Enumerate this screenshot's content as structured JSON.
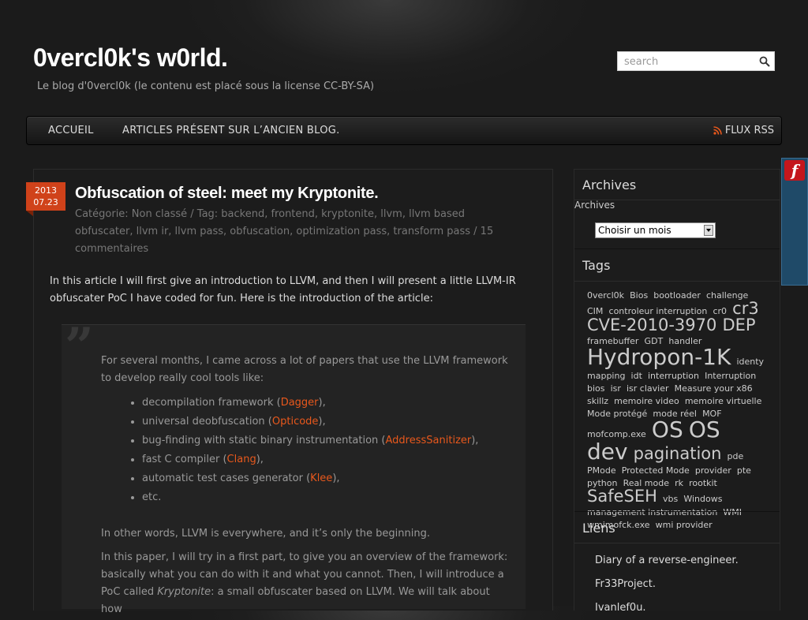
{
  "site": {
    "title": "0vercl0k's w0rld.",
    "description": "Le blog d'0vercl0k (le contenu est placé sous la license CC-BY-SA)"
  },
  "search": {
    "placeholder": "search",
    "icon": "search-icon"
  },
  "nav": {
    "items": [
      {
        "label": "ACCUEIL"
      },
      {
        "label": "ARTICLES PRÉSENT SUR L’ANCIEN BLOG."
      }
    ],
    "rss_label": "FLUX RSS"
  },
  "post": {
    "date_year": "2013",
    "date_day": "07.23",
    "title": "Obfuscation of steel: meet my Kryptonite.",
    "meta": "Catégorie: Non classé / Tag: backend, frontend, kryptonite, llvm, llvm based obfuscater, llvm ir, llvm pass, obfuscation, optimization pass, transform pass / 15 commentaires",
    "intro": "In this article I will first give an introduction to LLVM, and then I will present a little LLVM-IR obfuscater PoC I have coded for fun. Here is the introduction of the article:",
    "quote": {
      "p1": "For several months, I came across a lot of papers that use the LLVM framework to develop really cool tools like:",
      "list": [
        {
          "before": "decompilation framework (",
          "link": "Dagger",
          "after": "),"
        },
        {
          "before": "universal deobfuscation (",
          "link": "Opticode",
          "after": "),"
        },
        {
          "before": "bug-finding with static binary instrumentation (",
          "link": "AddressSanitizer",
          "after": "),"
        },
        {
          "before": "fast C compiler (",
          "link": "Clang",
          "after": "),"
        },
        {
          "before": "automatic test cases generator (",
          "link": "Klee",
          "after": "),"
        },
        {
          "before": "etc.",
          "link": "",
          "after": ""
        }
      ],
      "p2": "In other words, LLVM is everywhere, and it’s only the beginning.",
      "p3_start": "In this paper, I will try in a first part, to give you an overview of the framework: basically what you can do with it and what you cannot. Then, I will introduce a PoC called ",
      "p3_em": "Kryptonite",
      "p3_end": ": a small obfuscater based on LLVM. We will talk about how"
    }
  },
  "sidebar": {
    "archives_title": "Archives",
    "archives_label": "Archives",
    "archives_select": "Choisir un mois",
    "tags_title": "Tags",
    "tags": [
      {
        "text": "0vercl0k",
        "size": 11
      },
      {
        "text": "Bios",
        "size": 11
      },
      {
        "text": "bootloader",
        "size": 11
      },
      {
        "text": "challenge",
        "size": 11
      },
      {
        "text": "CIM",
        "size": 11
      },
      {
        "text": "controleur interruption",
        "size": 11
      },
      {
        "text": "cr0",
        "size": 11
      },
      {
        "text": "cr3",
        "size": 21
      },
      {
        "text": "CVE-2010-3970",
        "size": 21
      },
      {
        "text": "DEP",
        "size": 21
      },
      {
        "text": "framebuffer",
        "size": 11
      },
      {
        "text": "GDT",
        "size": 11
      },
      {
        "text": "handler",
        "size": 11
      },
      {
        "text": "Hydropon-1K",
        "size": 28
      },
      {
        "text": "identy mapping",
        "size": 11
      },
      {
        "text": "idt",
        "size": 11
      },
      {
        "text": "interruption",
        "size": 11
      },
      {
        "text": "Interruption bios",
        "size": 11
      },
      {
        "text": "isr",
        "size": 11
      },
      {
        "text": "isr clavier",
        "size": 11
      },
      {
        "text": "Measure your x86 skillz",
        "size": 11
      },
      {
        "text": "memoire video",
        "size": 11
      },
      {
        "text": "memoire virtuelle",
        "size": 11
      },
      {
        "text": "Mode protégé",
        "size": 11
      },
      {
        "text": "mode réel",
        "size": 11
      },
      {
        "text": "MOF",
        "size": 11
      },
      {
        "text": "mofcomp.exe",
        "size": 11
      },
      {
        "text": "OS",
        "size": 28
      },
      {
        "text": "OS dev",
        "size": 28
      },
      {
        "text": "pagination",
        "size": 21
      },
      {
        "text": "pde",
        "size": 11
      },
      {
        "text": "PMode",
        "size": 11
      },
      {
        "text": "Protected Mode",
        "size": 11
      },
      {
        "text": "provider",
        "size": 11
      },
      {
        "text": "pte",
        "size": 11
      },
      {
        "text": "python",
        "size": 11
      },
      {
        "text": "Real mode",
        "size": 11
      },
      {
        "text": "rk",
        "size": 11
      },
      {
        "text": "rootkit",
        "size": 11
      },
      {
        "text": "SafeSEH",
        "size": 21
      },
      {
        "text": "vbs",
        "size": 11
      },
      {
        "text": "Windows management instrumentation",
        "size": 11
      },
      {
        "text": "WMI",
        "size": 11
      },
      {
        "text": "wmimofck.exe",
        "size": 11
      },
      {
        "text": "wmi provider",
        "size": 11
      }
    ],
    "links_title": "Liens",
    "links": [
      {
        "label": "Diary of a reverse-engineer."
      },
      {
        "label": "Fr33Project."
      },
      {
        "label": "Ivanlef0u."
      }
    ]
  },
  "flash_icon": "flash-player-icon",
  "colors": {
    "accent": "#e8581c",
    "date_badge": "#d0421a"
  }
}
